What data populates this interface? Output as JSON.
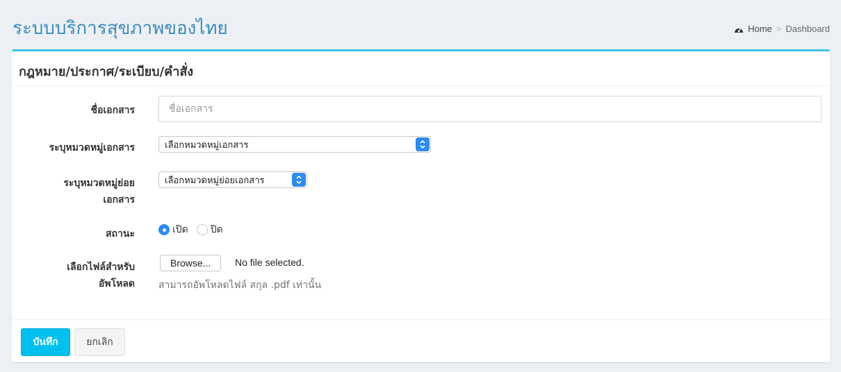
{
  "header": {
    "app_title": "ระบบบริการสุขภาพของไทย",
    "breadcrumb": {
      "home": "Home",
      "separator": ">",
      "current": "Dashboard"
    }
  },
  "form": {
    "title": "กฎหมาย/ประกาศ/ระเบียบ/คำสั่ง",
    "doc_name": {
      "label": "ชื่อเอกสาร",
      "placeholder": "ชื่อเอกสาร",
      "value": ""
    },
    "category": {
      "label": "ระบุหมวดหมู่เอกสาร",
      "selected": "เลือกหมวดหมู่เอกสาร"
    },
    "subcategory": {
      "label_line1": "ระบุหมวดหมู่ย่อย",
      "label_line2": "เอกสาร",
      "selected": "เลือกหมวดหมู่ย่อยเอกสาร"
    },
    "status": {
      "label": "สถานะ",
      "option_on": "เปิด",
      "option_off": "ปิด",
      "selected": "เปิด"
    },
    "file": {
      "label_line1": "เลือกไฟล์สำหรับ",
      "label_line2": "อัพโหลด",
      "browse_label": "Browse...",
      "status": "No file selected.",
      "help": "สามารถอัพโหลดไฟล์ สกุล .pdf เท่านั้น"
    }
  },
  "footer": {
    "save_label": "บันทึก",
    "cancel_label": "ยกเลิก"
  },
  "colors": {
    "accent": "#3c8dbc",
    "box_border": "#3fc2e6",
    "save_button": "#00c0ef",
    "select_chevron": "#2a8cf0"
  },
  "icons": {
    "breadcrumb_home": "dashboard-icon",
    "select": "chevron-updown-icon"
  }
}
